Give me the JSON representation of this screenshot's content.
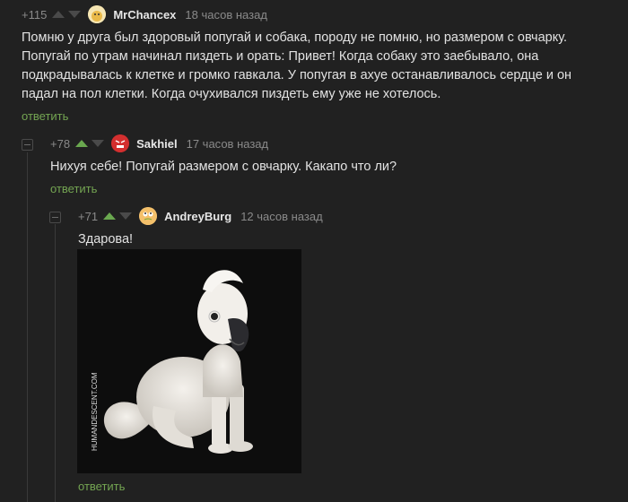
{
  "comments": [
    {
      "rating": "+115",
      "author": "MrChancex",
      "time": "18 часов назад",
      "text": "Помню у друга был здоровый попугай и собака, породу не помню, но размером с овчарку. Попугай по утрам начинал пиздеть и орать: Привет! Когда собаку это заебывало, она подкрадывалась к клетке и громко гавкала. У попугая в ахуе останавливалось сердце и он падал на пол клетки. Когда очухивался пиздеть ему уже не хотелось.",
      "reply": "ответить"
    },
    {
      "rating": "+78",
      "author": "Sakhiel",
      "time": "17 часов назад",
      "text": "Нихуя себе! Попугай размером с овчарку. Какапо что ли?",
      "reply": "ответить"
    },
    {
      "rating": "+71",
      "author": "AndreyBurg",
      "time": "12 часов назад",
      "text": "Здарова!",
      "image_watermark": "HUMANDESCENT.COM",
      "reply": "ответить"
    }
  ],
  "colors": {
    "background": "#212121",
    "reply_link": "#74a552",
    "vote_up_active": "#6aa84f"
  }
}
